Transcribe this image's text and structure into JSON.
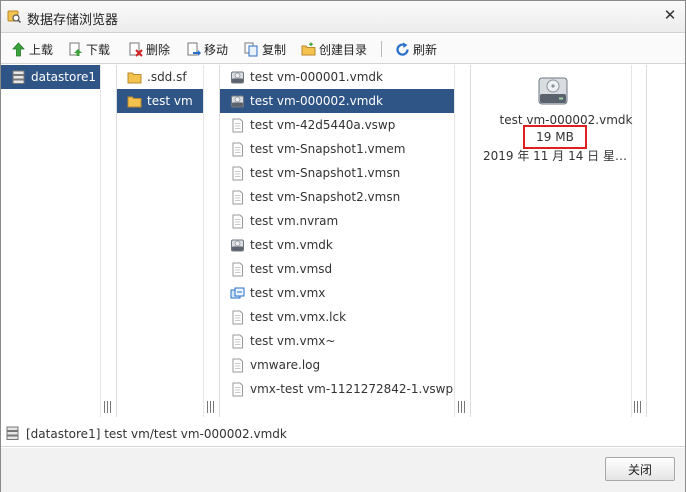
{
  "window": {
    "title": "数据存储浏览器",
    "close_glyph": "✕"
  },
  "toolbar": {
    "upload": "上载",
    "download": "下载",
    "delete": "删除",
    "move": "移动",
    "copy": "复制",
    "create_dir": "创建目录",
    "refresh": "刷新"
  },
  "datastores": [
    {
      "label": "datastore1",
      "selected": true,
      "icon": "datastore-icon"
    }
  ],
  "folders": [
    {
      "label": ".sdd.sf",
      "selected": false,
      "icon": "folder-icon"
    },
    {
      "label": "test vm",
      "selected": true,
      "icon": "folder-icon"
    }
  ],
  "files": [
    {
      "label": "test vm-000001.vmdk",
      "icon": "disk-icon",
      "selected": false
    },
    {
      "label": "test vm-000002.vmdk",
      "icon": "disk-icon",
      "selected": true
    },
    {
      "label": "test vm-42d5440a.vswp",
      "icon": "file-icon",
      "selected": false
    },
    {
      "label": "test vm-Snapshot1.vmem",
      "icon": "file-icon",
      "selected": false
    },
    {
      "label": "test vm-Snapshot1.vmsn",
      "icon": "file-icon",
      "selected": false
    },
    {
      "label": "test vm-Snapshot2.vmsn",
      "icon": "file-icon",
      "selected": false
    },
    {
      "label": "test vm.nvram",
      "icon": "file-icon",
      "selected": false
    },
    {
      "label": "test vm.vmdk",
      "icon": "disk-icon",
      "selected": false
    },
    {
      "label": "test vm.vmsd",
      "icon": "file-icon",
      "selected": false
    },
    {
      "label": "test vm.vmx",
      "icon": "vm-icon",
      "selected": false
    },
    {
      "label": "test vm.vmx.lck",
      "icon": "file-icon",
      "selected": false
    },
    {
      "label": "test vm.vmx~",
      "icon": "file-icon",
      "selected": false
    },
    {
      "label": "vmware.log",
      "icon": "file-icon",
      "selected": false
    },
    {
      "label": "vmx-test vm-1121272842-1.vswp",
      "icon": "file-icon",
      "selected": false
    }
  ],
  "detail": {
    "name": "test vm-000002.vmdk",
    "size": "19 MB",
    "date": "2019 年 11 月 14 日 星…"
  },
  "status": {
    "path": "[datastore1] test vm/test vm-000002.vmdk"
  },
  "footer": {
    "close_label": "关闭"
  },
  "colors": {
    "selection": "#2f5486",
    "highlight_border": "#e02020"
  }
}
